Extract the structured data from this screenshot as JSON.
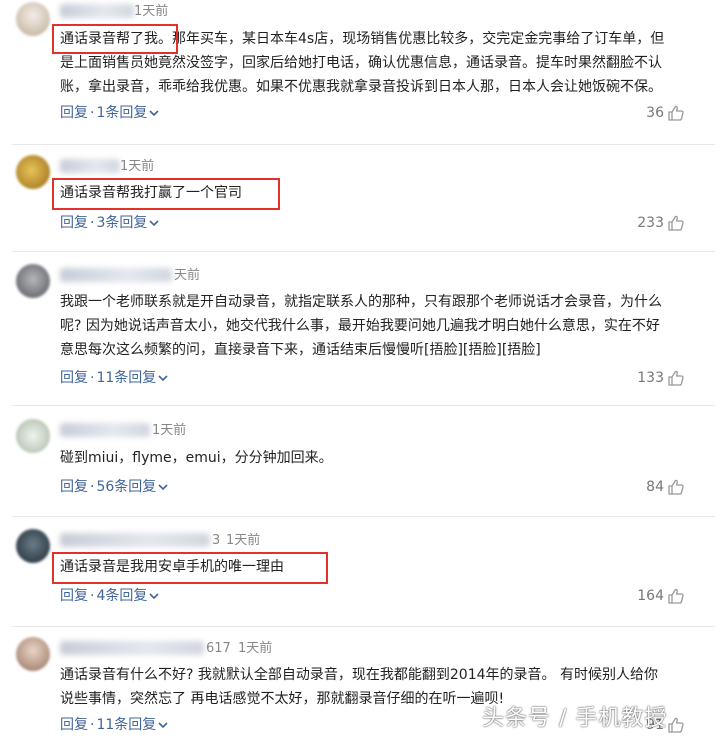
{
  "comments": [
    {
      "name_suffix": "",
      "time": "1天前",
      "lines": [
        "通话录音帮了我。那年买车，某日本车4s店，现场销售优惠比较多，交完定金完事给了订车单，但",
        "是上面销售员她竟然没签字，回家后给她打电话，确认优惠信息，通话录音。提车时果然翻脸不认",
        "账，拿出录音，乖乖给我优惠。如果不优惠我就拿录音投诉到日本人那，日本人会让她饭碗不保。"
      ],
      "reply_label": "回复",
      "reply_count": "1条回复",
      "likes": "36"
    },
    {
      "name_suffix": "",
      "time": "1天前",
      "lines": [
        "通话录音帮我打赢了一个官司"
      ],
      "reply_label": "回复",
      "reply_count": "3条回复",
      "likes": "233"
    },
    {
      "name_suffix": "",
      "time": "天前",
      "lines": [
        "我跟一个老师联系就是开自动录音，就指定联系人的那种，只有跟那个老师说话才会录音，为什么",
        "呢? 因为她说话声音太小，她交代我什么事，最开始我要问她几遍我才明白她什么意思，实在不好",
        "意思每次这么频繁的问，直接录音下来，通话结束后慢慢听[捂脸][捂脸][捂脸]"
      ],
      "reply_label": "回复",
      "reply_count": "11条回复",
      "likes": "133"
    },
    {
      "name_suffix": "",
      "time": "1天前",
      "lines": [
        "碰到miui，flyme，emui，分分钟加回来。"
      ],
      "reply_label": "回复",
      "reply_count": "56条回复",
      "likes": "84"
    },
    {
      "name_suffix": "3",
      "time": "1天前",
      "lines": [
        "通话录音是我用安卓手机的唯一理由"
      ],
      "reply_label": "回复",
      "reply_count": "4条回复",
      "likes": "164"
    },
    {
      "name_suffix": "617",
      "time": "1天前",
      "lines": [
        "通话录音有什么不好? 我就默认全部自动录音，现在我都能翻到2014年的录音。 有时候别人给你",
        "说些事情，突然忘了 再电话感觉不太好，那就翻录音仔细的在听一遍呗!"
      ],
      "reply_label": "回复",
      "reply_count": "11条回复",
      "likes": "91"
    }
  ],
  "watermark": "头条号 / 手机教授",
  "colors": {
    "link": "#406599",
    "highlight_box": "#e0312a",
    "meta": "#888888"
  },
  "icons": {
    "like": "thumbs-up-icon",
    "expand": "chevron-down-icon"
  }
}
